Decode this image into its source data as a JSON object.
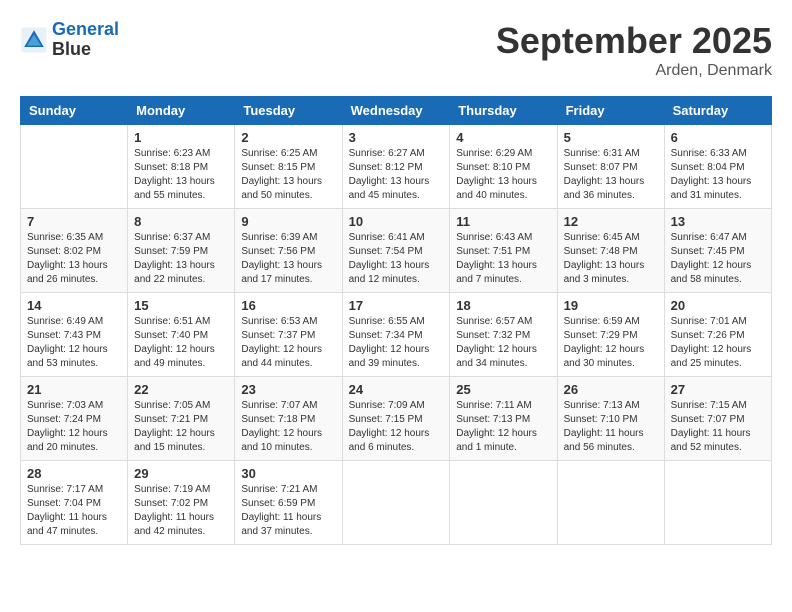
{
  "header": {
    "logo_line1": "General",
    "logo_line2": "Blue",
    "month_title": "September 2025",
    "location": "Arden, Denmark"
  },
  "calendar": {
    "days_of_week": [
      "Sunday",
      "Monday",
      "Tuesday",
      "Wednesday",
      "Thursday",
      "Friday",
      "Saturday"
    ],
    "weeks": [
      [
        {
          "day": "",
          "info": ""
        },
        {
          "day": "1",
          "info": "Sunrise: 6:23 AM\nSunset: 8:18 PM\nDaylight: 13 hours\nand 55 minutes."
        },
        {
          "day": "2",
          "info": "Sunrise: 6:25 AM\nSunset: 8:15 PM\nDaylight: 13 hours\nand 50 minutes."
        },
        {
          "day": "3",
          "info": "Sunrise: 6:27 AM\nSunset: 8:12 PM\nDaylight: 13 hours\nand 45 minutes."
        },
        {
          "day": "4",
          "info": "Sunrise: 6:29 AM\nSunset: 8:10 PM\nDaylight: 13 hours\nand 40 minutes."
        },
        {
          "day": "5",
          "info": "Sunrise: 6:31 AM\nSunset: 8:07 PM\nDaylight: 13 hours\nand 36 minutes."
        },
        {
          "day": "6",
          "info": "Sunrise: 6:33 AM\nSunset: 8:04 PM\nDaylight: 13 hours\nand 31 minutes."
        }
      ],
      [
        {
          "day": "7",
          "info": "Sunrise: 6:35 AM\nSunset: 8:02 PM\nDaylight: 13 hours\nand 26 minutes."
        },
        {
          "day": "8",
          "info": "Sunrise: 6:37 AM\nSunset: 7:59 PM\nDaylight: 13 hours\nand 22 minutes."
        },
        {
          "day": "9",
          "info": "Sunrise: 6:39 AM\nSunset: 7:56 PM\nDaylight: 13 hours\nand 17 minutes."
        },
        {
          "day": "10",
          "info": "Sunrise: 6:41 AM\nSunset: 7:54 PM\nDaylight: 13 hours\nand 12 minutes."
        },
        {
          "day": "11",
          "info": "Sunrise: 6:43 AM\nSunset: 7:51 PM\nDaylight: 13 hours\nand 7 minutes."
        },
        {
          "day": "12",
          "info": "Sunrise: 6:45 AM\nSunset: 7:48 PM\nDaylight: 13 hours\nand 3 minutes."
        },
        {
          "day": "13",
          "info": "Sunrise: 6:47 AM\nSunset: 7:45 PM\nDaylight: 12 hours\nand 58 minutes."
        }
      ],
      [
        {
          "day": "14",
          "info": "Sunrise: 6:49 AM\nSunset: 7:43 PM\nDaylight: 12 hours\nand 53 minutes."
        },
        {
          "day": "15",
          "info": "Sunrise: 6:51 AM\nSunset: 7:40 PM\nDaylight: 12 hours\nand 49 minutes."
        },
        {
          "day": "16",
          "info": "Sunrise: 6:53 AM\nSunset: 7:37 PM\nDaylight: 12 hours\nand 44 minutes."
        },
        {
          "day": "17",
          "info": "Sunrise: 6:55 AM\nSunset: 7:34 PM\nDaylight: 12 hours\nand 39 minutes."
        },
        {
          "day": "18",
          "info": "Sunrise: 6:57 AM\nSunset: 7:32 PM\nDaylight: 12 hours\nand 34 minutes."
        },
        {
          "day": "19",
          "info": "Sunrise: 6:59 AM\nSunset: 7:29 PM\nDaylight: 12 hours\nand 30 minutes."
        },
        {
          "day": "20",
          "info": "Sunrise: 7:01 AM\nSunset: 7:26 PM\nDaylight: 12 hours\nand 25 minutes."
        }
      ],
      [
        {
          "day": "21",
          "info": "Sunrise: 7:03 AM\nSunset: 7:24 PM\nDaylight: 12 hours\nand 20 minutes."
        },
        {
          "day": "22",
          "info": "Sunrise: 7:05 AM\nSunset: 7:21 PM\nDaylight: 12 hours\nand 15 minutes."
        },
        {
          "day": "23",
          "info": "Sunrise: 7:07 AM\nSunset: 7:18 PM\nDaylight: 12 hours\nand 10 minutes."
        },
        {
          "day": "24",
          "info": "Sunrise: 7:09 AM\nSunset: 7:15 PM\nDaylight: 12 hours\nand 6 minutes."
        },
        {
          "day": "25",
          "info": "Sunrise: 7:11 AM\nSunset: 7:13 PM\nDaylight: 12 hours\nand 1 minute."
        },
        {
          "day": "26",
          "info": "Sunrise: 7:13 AM\nSunset: 7:10 PM\nDaylight: 11 hours\nand 56 minutes."
        },
        {
          "day": "27",
          "info": "Sunrise: 7:15 AM\nSunset: 7:07 PM\nDaylight: 11 hours\nand 52 minutes."
        }
      ],
      [
        {
          "day": "28",
          "info": "Sunrise: 7:17 AM\nSunset: 7:04 PM\nDaylight: 11 hours\nand 47 minutes."
        },
        {
          "day": "29",
          "info": "Sunrise: 7:19 AM\nSunset: 7:02 PM\nDaylight: 11 hours\nand 42 minutes."
        },
        {
          "day": "30",
          "info": "Sunrise: 7:21 AM\nSunset: 6:59 PM\nDaylight: 11 hours\nand 37 minutes."
        },
        {
          "day": "",
          "info": ""
        },
        {
          "day": "",
          "info": ""
        },
        {
          "day": "",
          "info": ""
        },
        {
          "day": "",
          "info": ""
        }
      ]
    ]
  }
}
